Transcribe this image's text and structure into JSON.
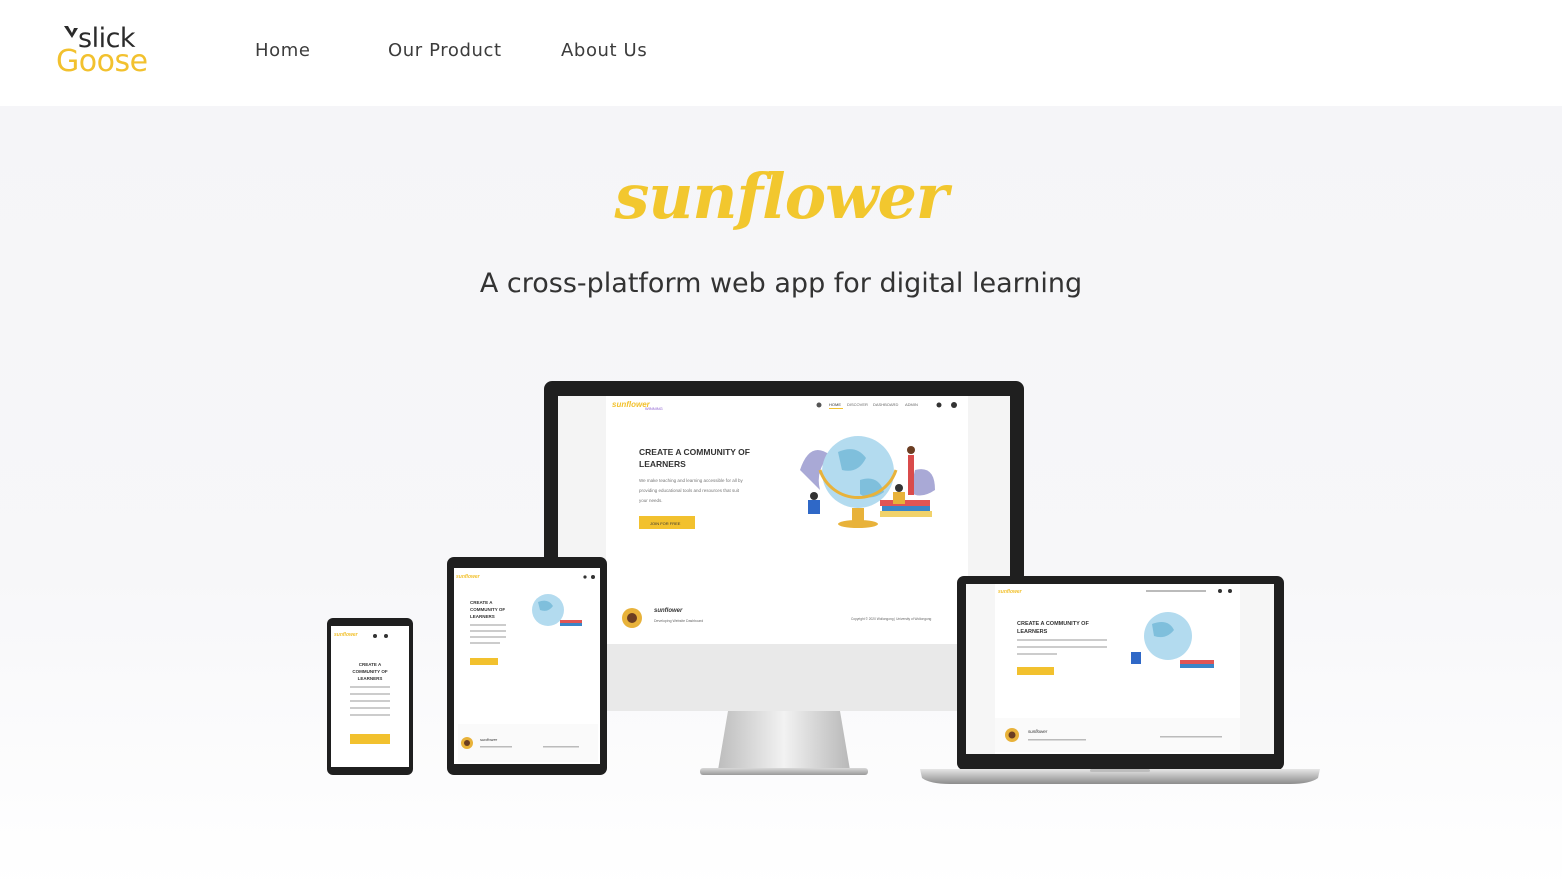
{
  "logo": {
    "line1": "slick",
    "line2": "Goose"
  },
  "nav": {
    "items": [
      {
        "label": "Home",
        "active": true
      },
      {
        "label": "Our Product",
        "active": false
      },
      {
        "label": "About Us",
        "active": false
      }
    ]
  },
  "hero": {
    "brand": "sunflower",
    "tagline": "A cross-platform web app for digital learning"
  },
  "mockup": {
    "brand": "sunflower",
    "sub": "WINNING",
    "nav": [
      "HOME",
      "DISCOVER",
      "DASHBOARD",
      "ADMIN"
    ],
    "heading_line1": "CREATE A COMMUNITY OF",
    "heading_line2": "LEARNERS",
    "body_line1": "We make teaching and learning accessible for all by",
    "body_line2": "providing educational tools and resources that suit",
    "body_line3": "your needs.",
    "cta": "JOIN FOR FREE",
    "footer_left": "Developing Website Dashboard",
    "footer_right": "Copyright © 2020 Wollongong | University of Wollongong"
  },
  "colors": {
    "accent": "#f2c12e",
    "text": "#333333",
    "hero_bg": "#f5f5f8"
  }
}
